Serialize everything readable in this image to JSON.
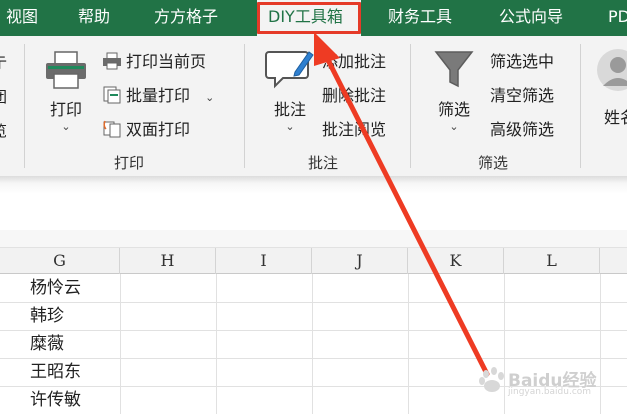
{
  "tabs": [
    {
      "label": "视图",
      "active": false
    },
    {
      "label": "帮助",
      "active": false
    },
    {
      "label": "方方格子",
      "active": false
    },
    {
      "label": "DIY工具箱",
      "active": true
    },
    {
      "label": "财务工具",
      "active": false
    },
    {
      "label": "公式向导",
      "active": false
    },
    {
      "label": "PD",
      "active": false
    }
  ],
  "ribbon": {
    "print_group": {
      "label": "打印",
      "print_button": "打印",
      "print_current_page": "打印当前页",
      "batch_print": "批量打印",
      "duplex_print": "双面打印"
    },
    "comment_group": {
      "label": "批注",
      "comment_button": "批注",
      "add_comment": "添加批注",
      "delete_comment": "删除批注",
      "read_comment": "批注阅览"
    },
    "filter_group": {
      "label": "筛选",
      "filter_button": "筛选",
      "filter_selected": "筛选选中",
      "clear_filter": "清空筛选",
      "advanced_filter": "高级筛选"
    },
    "name_group": {
      "button_label": "姓名"
    },
    "left_cut_chars": [
      "亍",
      "团",
      "览"
    ]
  },
  "grid": {
    "columns": [
      "G",
      "H",
      "I",
      "J",
      "K",
      "L"
    ],
    "cells": [
      "杨怜云",
      "韩珍",
      "糜薇",
      "王昭东",
      "许传敏"
    ]
  },
  "watermark": {
    "text": "Baidu经验",
    "sub": "jingyan.baidu.com"
  },
  "colors": {
    "accent": "#217346",
    "highlight": "#e53a28"
  }
}
